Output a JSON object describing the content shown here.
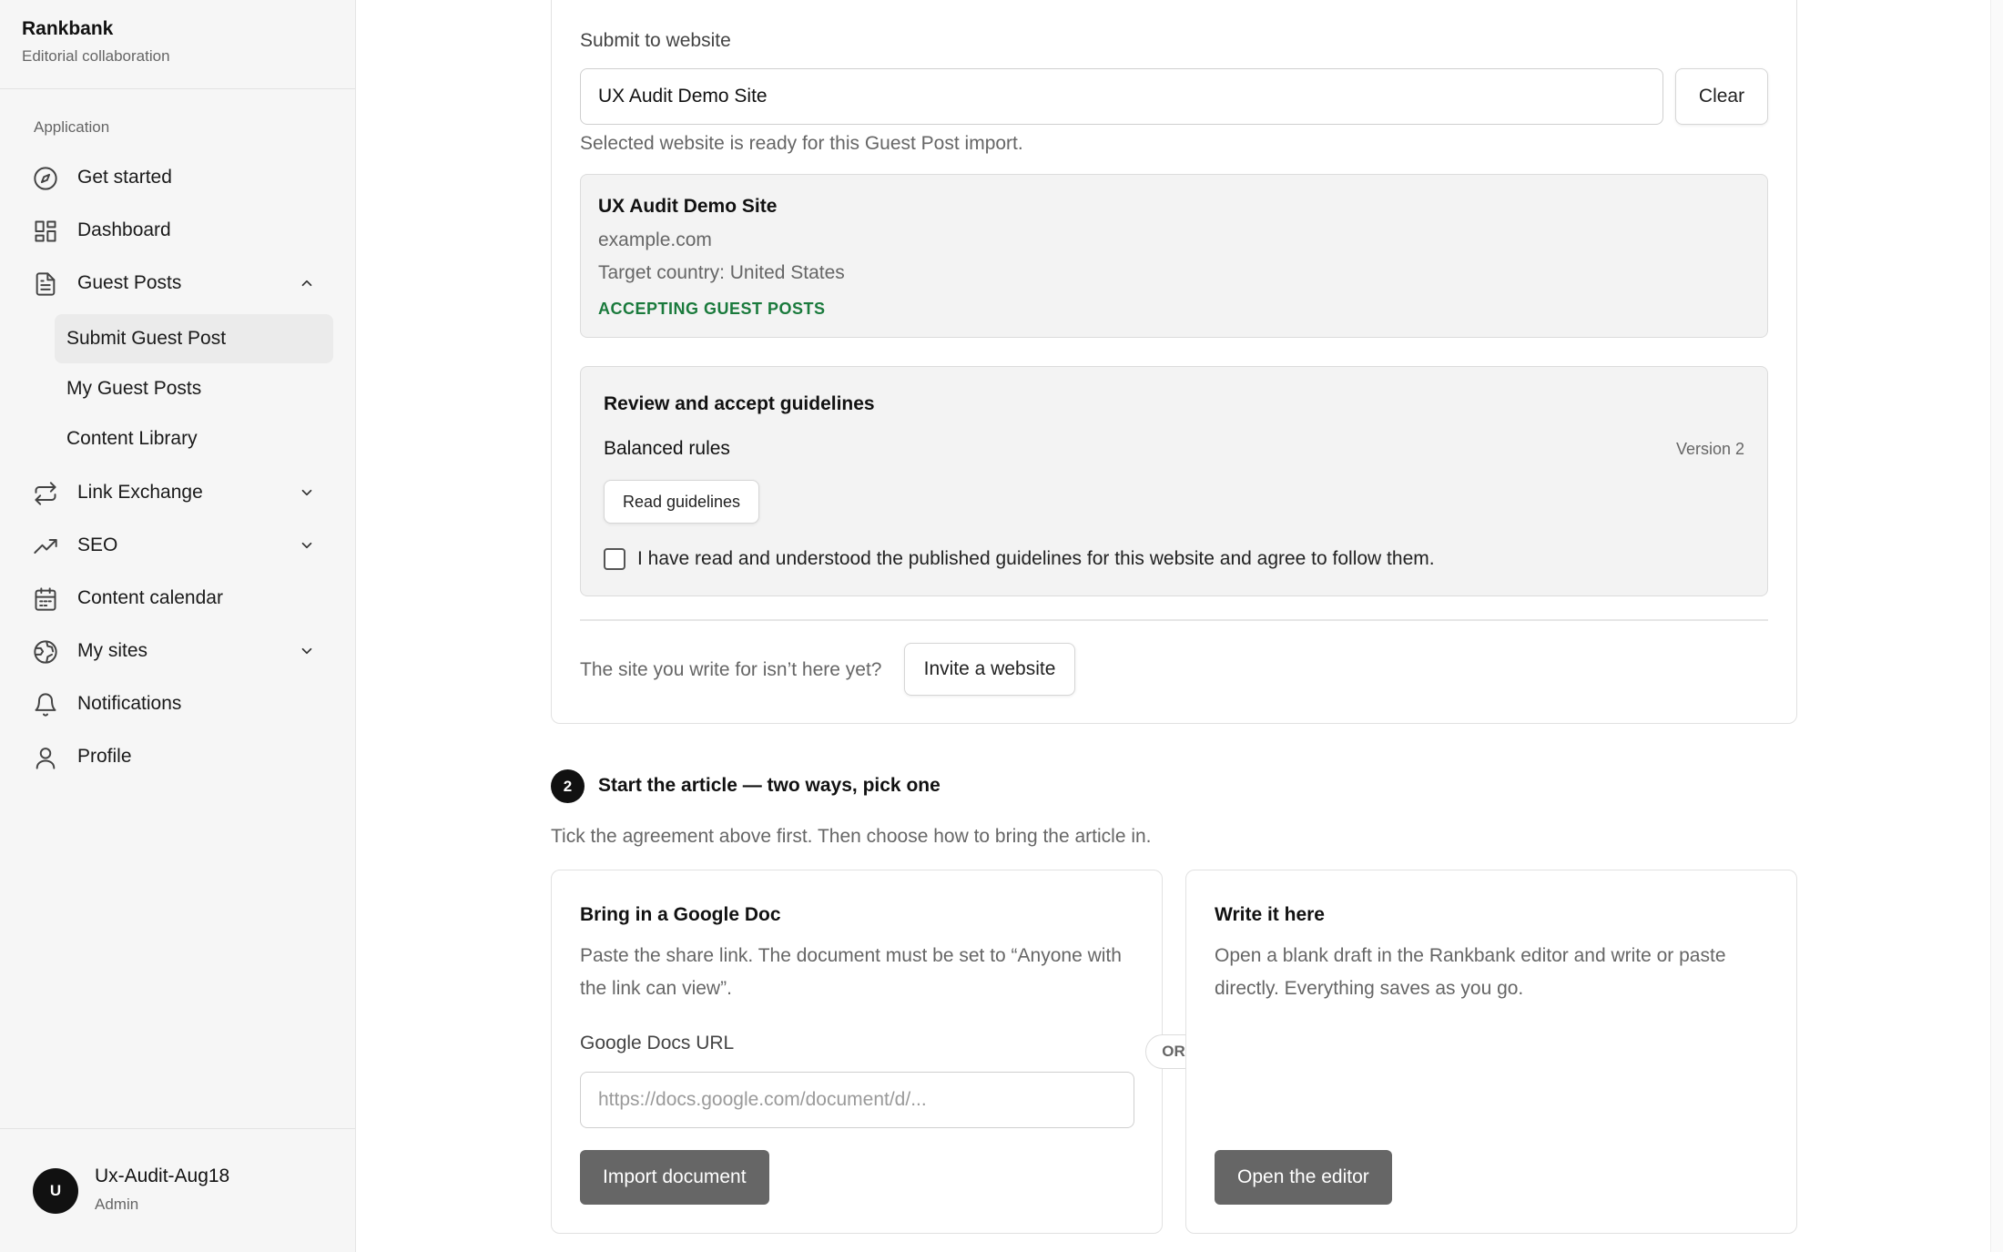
{
  "brand": {
    "name": "Rankbank",
    "subtitle": "Editorial collaboration"
  },
  "sidebar": {
    "section_label": "Application",
    "items": [
      {
        "label": "Get started",
        "icon": "compass-icon"
      },
      {
        "label": "Dashboard",
        "icon": "dashboard-grid-icon"
      },
      {
        "label": "Guest Posts",
        "icon": "document-icon",
        "expanded": true
      },
      {
        "label": "Link Exchange",
        "icon": "repeat-arrows-icon",
        "expanded": false
      },
      {
        "label": "SEO",
        "icon": "trending-up-icon",
        "expanded": false
      },
      {
        "label": "Content calendar",
        "icon": "calendar-icon"
      },
      {
        "label": "My sites",
        "icon": "globe-icon",
        "expanded": false
      },
      {
        "label": "Notifications",
        "icon": "bell-icon"
      },
      {
        "label": "Profile",
        "icon": "user-icon"
      }
    ],
    "guest_posts_sub": [
      {
        "label": "Submit Guest Post",
        "active": true
      },
      {
        "label": "My Guest Posts",
        "active": false
      },
      {
        "label": "Content Library",
        "active": false
      }
    ]
  },
  "user": {
    "initial": "U",
    "name": "Ux-Audit-Aug18",
    "role": "Admin"
  },
  "submit": {
    "label": "Submit to website",
    "value": "UX Audit Demo Site",
    "clear_label": "Clear",
    "helper": "Selected website is ready for this Guest Post import."
  },
  "site": {
    "name": "UX Audit Demo Site",
    "domain": "example.com",
    "country": "Target country: United States",
    "status": "ACCEPTING GUEST POSTS",
    "status_color": "#1a7a3c"
  },
  "guidelines": {
    "title": "Review and accept guidelines",
    "rules": "Balanced rules",
    "version": "Version 2",
    "read_label": "Read guidelines",
    "agree_label": "I have read and understood the published guidelines for this website and agree to follow them.",
    "agreed": false
  },
  "invite": {
    "prompt": "The site you write for isn’t here yet?",
    "button": "Invite a website"
  },
  "step2": {
    "number": "2",
    "title": "Start the article — two ways, pick one",
    "subtitle": "Tick the agreement above first. Then choose how to bring the article in.",
    "or_label": "OR",
    "google": {
      "title": "Bring in a Google Doc",
      "desc": "Paste the share link. The document must be set to “Anyone with the link can view”.",
      "url_label": "Google Docs URL",
      "url_placeholder": "https://docs.google.com/document/d/...",
      "button": "Import document"
    },
    "write": {
      "title": "Write it here",
      "desc": "Open a blank draft in the Rankbank editor and write or paste directly. Everything saves as you go.",
      "button": "Open the editor"
    }
  }
}
